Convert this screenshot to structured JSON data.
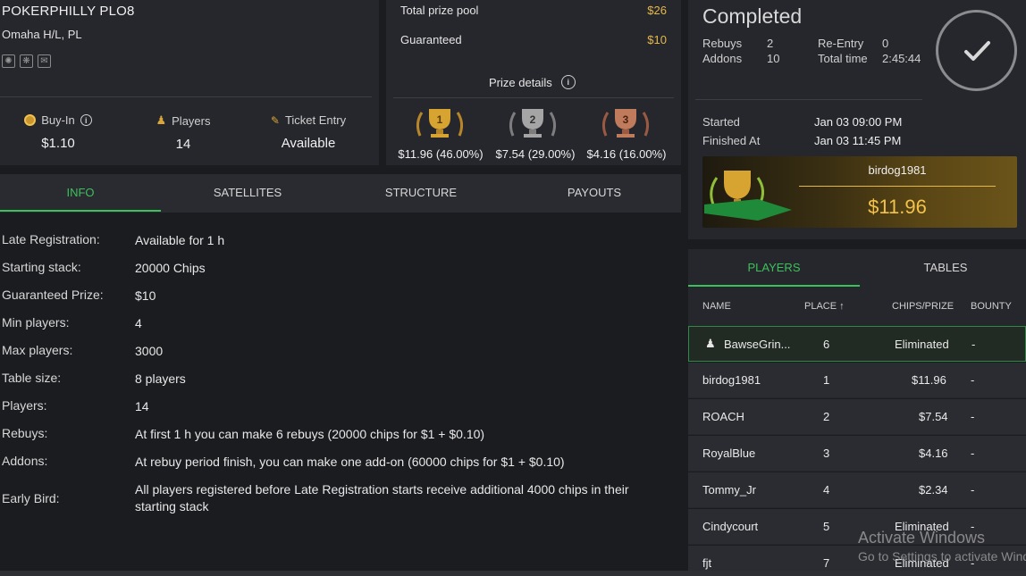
{
  "tournament": {
    "name": "POKERPHILLY PLO8",
    "game": "Omaha H/L, PL",
    "buyin_label": "Buy-In",
    "buyin_value": "$1.10",
    "players_label": "Players",
    "players_value": "14",
    "ticket_label": "Ticket Entry",
    "ticket_value": "Available"
  },
  "prizes": {
    "total_label": "Total prize pool",
    "total_value": "$26",
    "guaranteed_label": "Guaranteed",
    "guaranteed_value": "$10",
    "details_label": "Prize details",
    "places": [
      {
        "rank": "1",
        "amount": "$11.96 (46.00%)",
        "color": "#d7a431"
      },
      {
        "rank": "2",
        "amount": "$7.54 (29.00%)",
        "color": "#9c9c9c"
      },
      {
        "rank": "3",
        "amount": "$4.16 (16.00%)",
        "color": "#c07a5c"
      }
    ]
  },
  "tabs": [
    "INFO",
    "SATELLITES",
    "STRUCTURE",
    "PAYOUTS"
  ],
  "info": [
    {
      "k": "Late Registration:",
      "v": "Available for 1 h"
    },
    {
      "k": "Starting stack:",
      "v": "20000 Chips"
    },
    {
      "k": "Guaranteed Prize:",
      "v": "$10"
    },
    {
      "k": "Min players:",
      "v": "4"
    },
    {
      "k": "Max players:",
      "v": "3000"
    },
    {
      "k": "Table size:",
      "v": "8 players"
    },
    {
      "k": "Players:",
      "v": "14"
    },
    {
      "k": "Rebuys:",
      "v": "At first 1 h you can make 6 rebuys (20000 chips for $1 + $0.10)"
    },
    {
      "k": "Addons:",
      "v": "At rebuy period finish, you can make one add-on (60000 chips for $1 + $0.10)"
    },
    {
      "k": "Early Bird:",
      "v": "All players registered before Late Registration starts receive additional 4000 chips in their starting stack"
    }
  ],
  "status": {
    "title": "Completed",
    "rebuys_label": "Rebuys",
    "rebuys_value": "2",
    "addons_label": "Addons",
    "addons_value": "10",
    "reentry_label": "Re-Entry",
    "reentry_value": "0",
    "totaltime_label": "Total time",
    "totaltime_value": "2:45:44",
    "started_label": "Started",
    "started_value": "Jan 03 09:00 PM",
    "finished_label": "Finished At",
    "finished_value": "Jan 03 11:45 PM"
  },
  "winner": {
    "name": "birdog1981",
    "prize": "$11.96"
  },
  "players_tabs": [
    "PLAYERS",
    "TABLES"
  ],
  "players_headers": {
    "name": "NAME",
    "place": "PLACE ↑",
    "chips": "CHIPS/PRIZE",
    "bounty": "BOUNTY"
  },
  "players": [
    {
      "name": "BawseGrin...",
      "place": "6",
      "prize": "Eliminated",
      "bounty": "-"
    },
    {
      "name": "birdog1981",
      "place": "1",
      "prize": "$11.96",
      "bounty": "-"
    },
    {
      "name": "ROACH",
      "place": "2",
      "prize": "$7.54",
      "bounty": "-"
    },
    {
      "name": "RoyalBlue",
      "place": "3",
      "prize": "$4.16",
      "bounty": "-"
    },
    {
      "name": "Tommy_Jr",
      "place": "4",
      "prize": "$2.34",
      "bounty": "-"
    },
    {
      "name": "Cindycourt",
      "place": "5",
      "prize": "Eliminated",
      "bounty": "-"
    },
    {
      "name": "fjt",
      "place": "7",
      "prize": "Eliminated",
      "bounty": "-"
    }
  ],
  "watermark": {
    "line1": "Activate Windows",
    "line2": "Go to Settings to activate Windows."
  }
}
